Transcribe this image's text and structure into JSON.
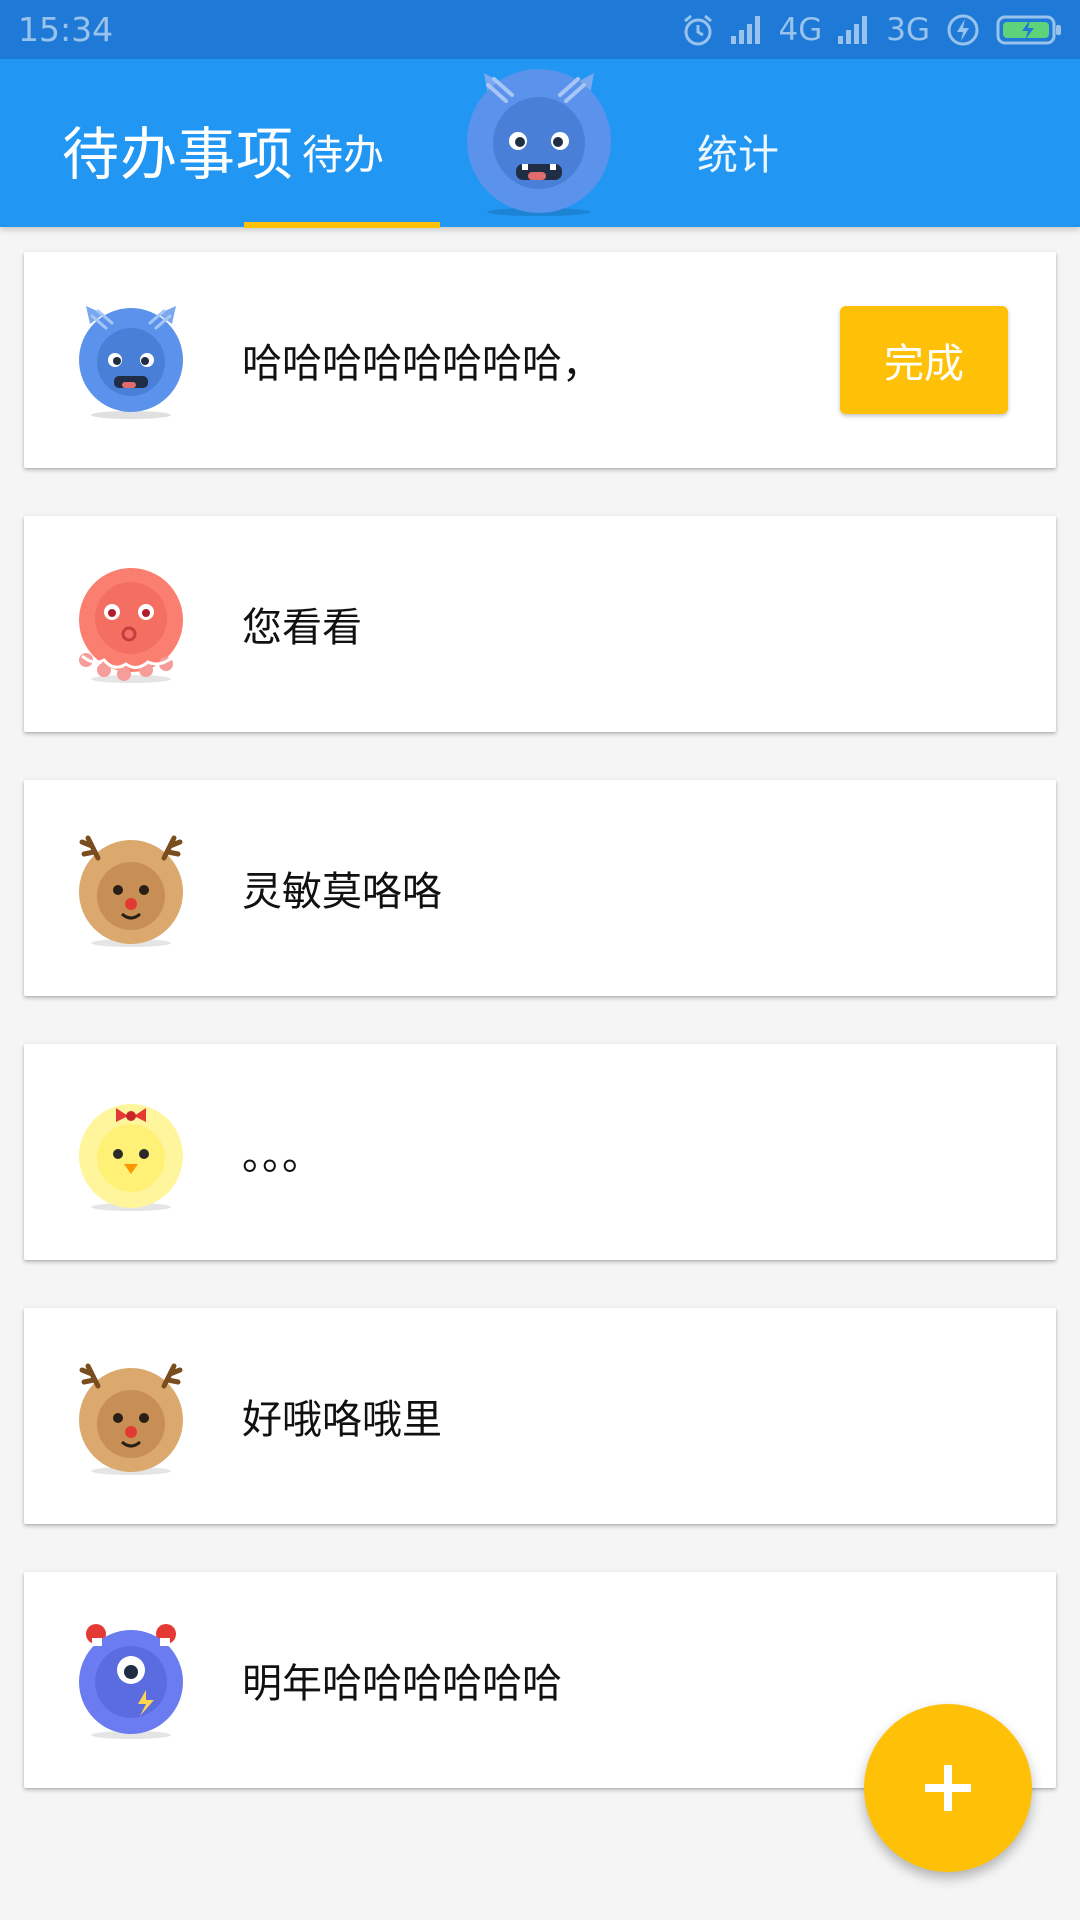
{
  "status_bar": {
    "time": "15:34",
    "network_1": "4G",
    "network_2": "3G",
    "icons": [
      "alarm-icon",
      "signal-icon",
      "signal-icon",
      "charging-icon",
      "battery-icon"
    ]
  },
  "header": {
    "title": "待办事项",
    "tabs": [
      {
        "label": "待办",
        "selected": true
      },
      {
        "label": "统计",
        "selected": false
      }
    ],
    "avatar_icon": "blue-monster-avatar",
    "accent_color": "#ffc107",
    "bar_color": "#2196f3"
  },
  "todos": [
    {
      "text": "哈哈哈哈哈哈哈哈，",
      "avatar": "blue-monster-avatar",
      "action_label": "完成"
    },
    {
      "text": "您看看",
      "avatar": "red-octopus-avatar"
    },
    {
      "text": "灵敏莫咯咯",
      "avatar": "reindeer-avatar"
    },
    {
      "text": "。。。",
      "avatar": "yellow-chick-avatar"
    },
    {
      "text": "好哦咯哦里",
      "avatar": "reindeer-avatar"
    },
    {
      "text": "明年哈哈哈哈哈哈",
      "avatar": "purple-cyclops-avatar"
    }
  ],
  "fab": {
    "icon": "plus-icon",
    "color": "#ffc107"
  }
}
